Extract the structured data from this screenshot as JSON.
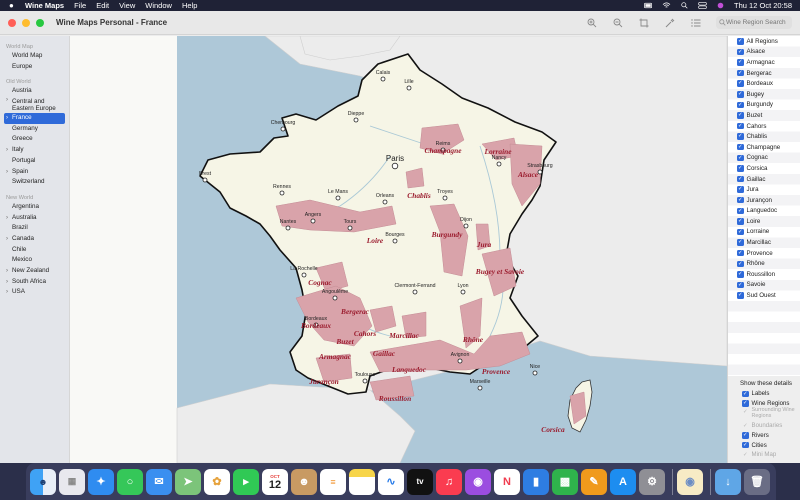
{
  "menubar": {
    "app_name": "Wine Maps",
    "menus": [
      "File",
      "Edit",
      "View",
      "Window",
      "Help"
    ],
    "datetime": "Thu 12 Oct  20:58"
  },
  "window": {
    "title": "Wine Maps Personal - France",
    "search_placeholder": "Wine Region Search"
  },
  "sidebar": {
    "sections": [
      {
        "header": "World Map",
        "items": [
          {
            "label": "World Map",
            "chevron": false
          },
          {
            "label": "Europe",
            "chevron": false
          }
        ]
      },
      {
        "header": "Old World",
        "items": [
          {
            "label": "Austria",
            "chevron": false
          },
          {
            "label": "Central and Eastern Europe",
            "chevron": true
          },
          {
            "label": "France",
            "chevron": true,
            "selected": true
          },
          {
            "label": "Germany",
            "chevron": false
          },
          {
            "label": "Greece",
            "chevron": false
          },
          {
            "label": "Italy",
            "chevron": true
          },
          {
            "label": "Portugal",
            "chevron": false
          },
          {
            "label": "Spain",
            "chevron": true
          },
          {
            "label": "Switzerland",
            "chevron": false
          }
        ]
      },
      {
        "header": "New World",
        "items": [
          {
            "label": "Argentina",
            "chevron": false
          },
          {
            "label": "Australia",
            "chevron": true
          },
          {
            "label": "Brazil",
            "chevron": false
          },
          {
            "label": "Canada",
            "chevron": true
          },
          {
            "label": "Chile",
            "chevron": false
          },
          {
            "label": "Mexico",
            "chevron": false
          },
          {
            "label": "New Zealand",
            "chevron": true
          },
          {
            "label": "South Africa",
            "chevron": true
          },
          {
            "label": "USA",
            "chevron": true
          }
        ]
      }
    ]
  },
  "regions_panel": {
    "items": [
      "All Regions",
      "Alsace",
      "Armagnac",
      "Bergerac",
      "Bordeaux",
      "Bugey",
      "Burgundy",
      "Buzet",
      "Cahors",
      "Chablis",
      "Champagne",
      "Cognac",
      "Corsica",
      "Gaillac",
      "Jura",
      "Jurançon",
      "Languedoc",
      "Loire",
      "Lorraine",
      "Marcillac",
      "Provence",
      "Rhône",
      "Roussillon",
      "Savoie",
      "Sud Ouest"
    ]
  },
  "details_panel": {
    "header": "Show these details",
    "items": [
      {
        "label": "Labels",
        "checked": true,
        "enabled": true
      },
      {
        "label": "Wine Regions",
        "checked": true,
        "enabled": true
      },
      {
        "label": "Surrounding Wine Regions",
        "checked": true,
        "enabled": false
      },
      {
        "label": "Boundaries",
        "checked": true,
        "enabled": false
      },
      {
        "label": "Rivers",
        "checked": true,
        "enabled": true
      },
      {
        "label": "Cities",
        "checked": true,
        "enabled": true
      },
      {
        "label": "Mini Map",
        "checked": true,
        "enabled": false
      }
    ]
  },
  "map": {
    "colors": {
      "sea": "#aec8d8",
      "land": "#f6f5e6",
      "neighbors": "#ededed",
      "wine": "#d9a3aa",
      "label": "#9b1c2e",
      "river": "#a9c8d6"
    },
    "cities": [
      "Calais",
      "Lille",
      "Dieppe",
      "Cherbourg",
      "Reims",
      "Paris",
      "Nancy",
      "Strasbourg",
      "Brest",
      "Rennes",
      "Le Mans",
      "Orleans",
      "Troyes",
      "Angers",
      "Nantes",
      "Tours",
      "Dijon",
      "Bourges",
      "La Rochelle",
      "Clermont-Ferrand",
      "Lyon",
      "Angoulême",
      "Bordeaux",
      "Avignon",
      "Nice",
      "Toulouse",
      "Marseille"
    ],
    "wine_labels": [
      "Champagne",
      "Lorraine",
      "Alsace",
      "Chablis",
      "Loire",
      "Burgundy",
      "Jura",
      "Cognac",
      "Bugey et Savoie",
      "Bergerac",
      "Bordeaux",
      "Cahors",
      "Buzet",
      "Marcillac",
      "Gaillac",
      "Rhône",
      "Armagnac",
      "Languedoc",
      "Provence",
      "Jurançon",
      "Roussillon",
      "Corsica"
    ]
  },
  "dock": {
    "icons": [
      "finder-icon",
      "launchpad-icon",
      "safari-icon",
      "messages-icon",
      "mail-icon",
      "maps-icon",
      "photos-icon",
      "facetime-icon",
      "calendar-icon",
      "contacts-icon",
      "reminders-icon",
      "notes-icon",
      "freeform-icon",
      "tv-icon",
      "music-icon",
      "podcasts-icon",
      "news-icon",
      "keynote-icon",
      "numbers-icon",
      "pages-icon",
      "app-store-icon",
      "system-settings-icon",
      "wine-maps-icon",
      "downloads-folder-icon",
      "trash-icon"
    ],
    "calendar_month": "OCT",
    "calendar_day": "12",
    "tv_label": "tv"
  }
}
